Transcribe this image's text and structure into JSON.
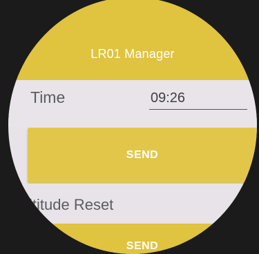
{
  "app": {
    "title": "LR01 Manager"
  },
  "time_row": {
    "label": "Time",
    "value": "09:26"
  },
  "send_button": {
    "label": "SEND"
  },
  "reset_row": {
    "label": "ltitude Reset"
  },
  "reset_send_button": {
    "label": "SEND"
  },
  "colors": {
    "accent": "#e0c33e",
    "background": "#e8e3e9",
    "text": "#5c5c60"
  }
}
